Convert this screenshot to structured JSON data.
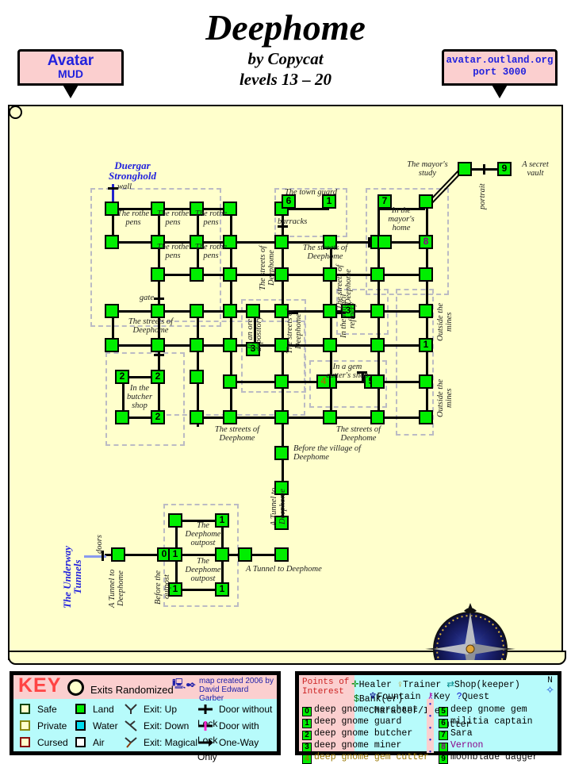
{
  "header": {
    "title": "Deephome",
    "author": "by Copycat",
    "levels": "levels 13 – 20",
    "banner_left_line1": "Avatar",
    "banner_left_line2": "MUD",
    "banner_right_line1": "avatar.outland.org",
    "banner_right_line2": "port 3000"
  },
  "map": {
    "area_labels": [
      {
        "text": "Duergar Stronghold",
        "kind": "blue"
      },
      {
        "text": "The Underway Tunnels",
        "kind": "blue"
      },
      {
        "text": "wall",
        "kind": "italic"
      },
      {
        "text": "gate",
        "kind": "italic"
      },
      {
        "text": "doors",
        "kind": "italic"
      },
      {
        "text": "portrait",
        "kind": "italic"
      },
      {
        "text": "barracks",
        "kind": "italic"
      }
    ],
    "rooms": [
      {
        "id": "rothe-pens-1",
        "label": "The rothe pens"
      },
      {
        "id": "rothe-pens-2",
        "label": "The rothe pens"
      },
      {
        "id": "rothe-pens-3",
        "label": "The rothe pens"
      },
      {
        "id": "rothe-pens-4",
        "label": "The rothe pens"
      },
      {
        "id": "rothe-pens-5",
        "label": "The rothe pens"
      },
      {
        "id": "town-guard",
        "label": "The town guard"
      },
      {
        "id": "mayors-home",
        "label": "In the mayor's home"
      },
      {
        "id": "mayors-study",
        "label": "The mayor's study"
      },
      {
        "id": "secret-vault",
        "label": "A secret vault"
      },
      {
        "id": "streets-1",
        "label": "The streets of Deephome"
      },
      {
        "id": "streets-2",
        "label": "The streets of Deephome"
      },
      {
        "id": "streets-3",
        "label": "The streets of Deephome"
      },
      {
        "id": "streets-4",
        "label": "The streets of Deephome"
      },
      {
        "id": "streets-5",
        "label": "The streets of Deephome"
      },
      {
        "id": "streets-6",
        "label": "The streets of Deephome"
      },
      {
        "id": "streets-7",
        "label": "The streets of Deephome"
      },
      {
        "id": "streets-8",
        "label": "The streets of Deephome"
      },
      {
        "id": "butcher-shop",
        "label": "In the butcher shop"
      },
      {
        "id": "ore-depository",
        "label": "In an ore depository"
      },
      {
        "id": "mithril-refinery",
        "label": "In the mithril refinery"
      },
      {
        "id": "gem-cutter",
        "label": "In a gem cutter's shop"
      },
      {
        "id": "outside-mines-1",
        "label": "Outside the mines"
      },
      {
        "id": "outside-mines-2",
        "label": "Outside the mines"
      },
      {
        "id": "before-village",
        "label": "Before the village of Deephome"
      },
      {
        "id": "tunnel-1",
        "label": "A Tunnel to Deephome"
      },
      {
        "id": "tunnel-2",
        "label": "A Tunnel to Deephome"
      },
      {
        "id": "tunnel-3",
        "label": "A Tunnel to Deephome"
      },
      {
        "id": "before-outpost",
        "label": "Before the outpost"
      },
      {
        "id": "outpost-1",
        "label": "The Deephome outpost"
      },
      {
        "id": "outpost-2",
        "label": "The Deephome outpost"
      }
    ]
  },
  "key": {
    "title": "KEY",
    "randomized_label": "Exits Randomized",
    "credit_line1": "map created 2006 by",
    "credit_line2": "David Edward Garber",
    "columns": [
      [
        {
          "label": "Safe",
          "color": "#ffffcc",
          "border": "#114411"
        },
        {
          "label": "Private",
          "color": "#ffffcc",
          "border": "#888811"
        },
        {
          "label": "Cursed",
          "color": "#ffffcc",
          "border": "#881111"
        }
      ],
      [
        {
          "label": "Land",
          "color": "#00ee00",
          "border": "#000000"
        },
        {
          "label": "Water",
          "color": "#00ddee",
          "border": "#000000"
        },
        {
          "label": "Air",
          "color": "#ffffff",
          "border": "#000000"
        }
      ],
      [
        {
          "label": "Exit: Up",
          "icon": "exit-up-icon"
        },
        {
          "label": "Exit: Down",
          "icon": "exit-down-icon"
        },
        {
          "label": "Exit: Magical",
          "icon": "exit-magical-icon"
        }
      ],
      [
        {
          "label": "Door without Lock",
          "icon": "door-plain-icon"
        },
        {
          "label": "Door with Lock",
          "icon": "door-lock-icon"
        },
        {
          "label": "One-Way Only",
          "icon": "one-way-icon"
        }
      ]
    ]
  },
  "poi": {
    "title_line1": "Points of",
    "title_line2": "Interest",
    "symbols": [
      {
        "glyph": "✛",
        "label": "Healer",
        "color": "#008800"
      },
      {
        "glyph": "♀",
        "label": "Trainer",
        "color": "#bb8800"
      },
      {
        "glyph": "⇄",
        "label": "Shop(keeper)",
        "color": "#008888"
      },
      {
        "glyph": "$",
        "label": "Bank(er)",
        "color": "#006600"
      },
      {
        "glyph": "⛲",
        "label": "Fountain",
        "color": "#000088"
      },
      {
        "glyph": "⚷",
        "label": "Key",
        "color": "#aa00aa"
      },
      {
        "glyph": "?",
        "label": "Quest Character/Item",
        "color": "#0000cc"
      }
    ],
    "compass_label": "N",
    "left_items": [
      {
        "num": "0",
        "label": "deep gnome merchant",
        "color": "#000000"
      },
      {
        "num": "1",
        "label": "deep gnome guard",
        "color": "#000000"
      },
      {
        "num": "2",
        "label": "deep gnome butcher",
        "color": "#000000"
      },
      {
        "num": "3",
        "label": "deep gnome miner",
        "color": "#000000"
      },
      {
        "num": "4",
        "label": "deep gnome gem cutter",
        "color": "#997700"
      }
    ],
    "right_items": [
      {
        "num": "5",
        "label": "deep gnome gem cutter",
        "color": "#000000"
      },
      {
        "num": "6",
        "label": "militia captain",
        "color": "#000000"
      },
      {
        "num": "7",
        "label": "Sara",
        "color": "#000000"
      },
      {
        "num": "8",
        "label": "Vernon",
        "color": "#880088"
      },
      {
        "num": "9",
        "label": "moonblade dagger",
        "color": "#000000"
      }
    ]
  }
}
